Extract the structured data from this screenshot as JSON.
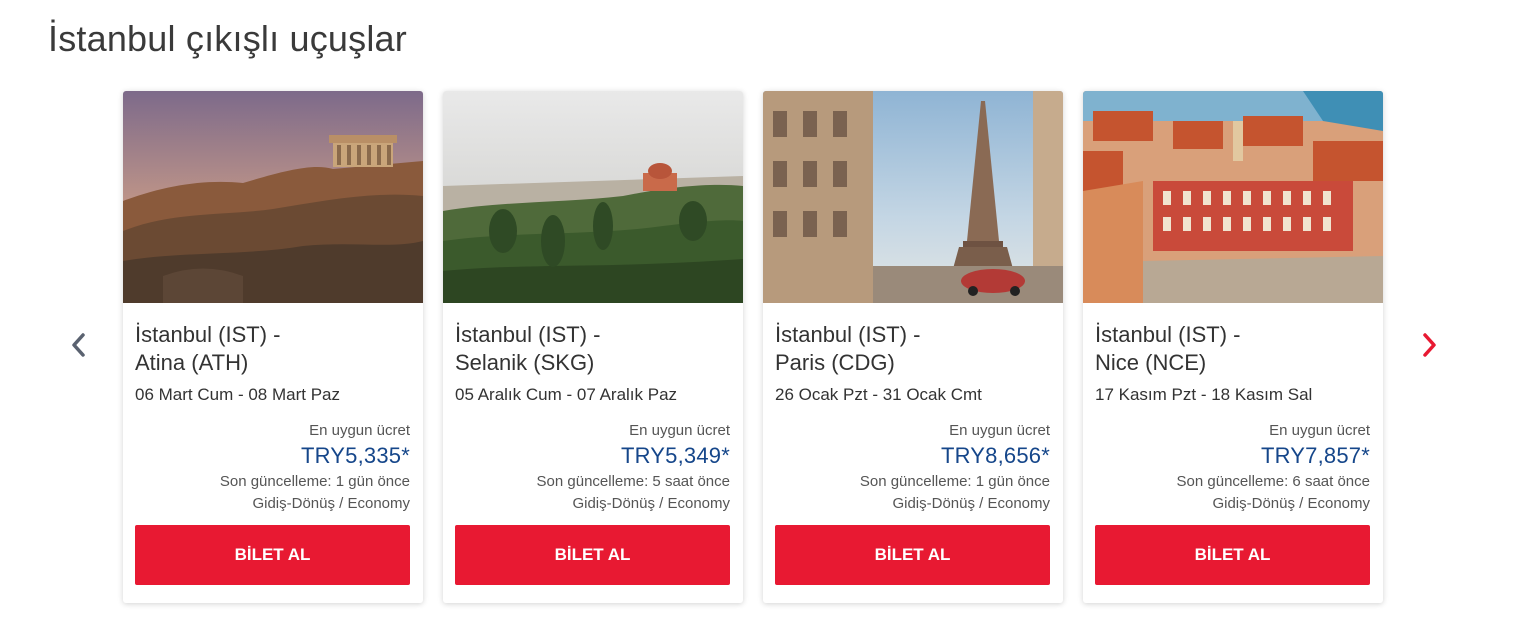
{
  "section": {
    "title": "İstanbul çıkışlı uçuşlar"
  },
  "nav": {
    "prev_icon": "chevron-left-icon",
    "next_icon": "chevron-right-icon",
    "accent": "#e81932",
    "muted": "#5a6270"
  },
  "cards": [
    {
      "image": "athens-acropolis-photo",
      "origin": "İstanbul (IST) -",
      "destination": "Atina (ATH)",
      "dates": "06 Mart Cum - 08 Mart Paz",
      "price_label": "En uygun ücret",
      "price": "TRY5,335*",
      "updated": "Son güncelleme: 1 gün önce",
      "trip": "Gidiş-Dönüş / Economy",
      "button": "BİLET AL"
    },
    {
      "image": "thessaloniki-photo",
      "origin": "İstanbul (IST) -",
      "destination": "Selanik (SKG)",
      "dates": "05 Aralık Cum - 07 Aralık Paz",
      "price_label": "En uygun ücret",
      "price": "TRY5,349*",
      "updated": "Son güncelleme: 5 saat önce",
      "trip": "Gidiş-Dönüş / Economy",
      "button": "BİLET AL"
    },
    {
      "image": "paris-eiffel-photo",
      "origin": "İstanbul (IST) -",
      "destination": "Paris (CDG)",
      "dates": "26 Ocak Pzt - 31 Ocak Cmt",
      "price_label": "En uygun ücret",
      "price": "TRY8,656*",
      "updated": "Son güncelleme: 1 gün önce",
      "trip": "Gidiş-Dönüş / Economy",
      "button": "BİLET AL"
    },
    {
      "image": "nice-rooftops-photo",
      "origin": "İstanbul (IST) -",
      "destination": "Nice (NCE)",
      "dates": "17 Kasım Pzt - 18 Kasım Sal",
      "price_label": "En uygun ücret",
      "price": "TRY7,857*",
      "updated": "Son güncelleme: 6 saat önce",
      "trip": "Gidiş-Dönüş / Economy",
      "button": "BİLET AL"
    }
  ]
}
